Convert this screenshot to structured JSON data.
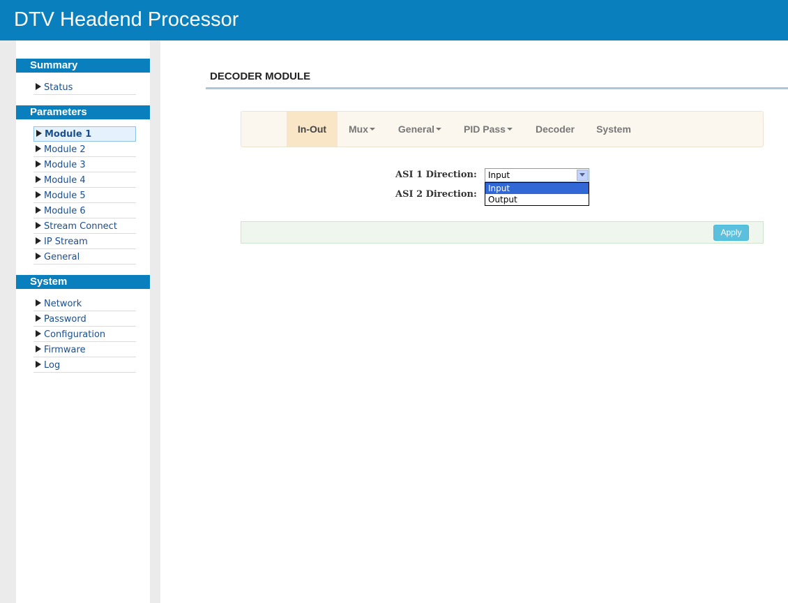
{
  "header": {
    "title": "DTV Headend Processor"
  },
  "sidebar": {
    "summary": {
      "heading": "Summary",
      "items": [
        {
          "label": "Status"
        }
      ]
    },
    "parameters": {
      "heading": "Parameters",
      "items": [
        {
          "label": "Module 1",
          "active": true
        },
        {
          "label": "Module 2"
        },
        {
          "label": "Module 3"
        },
        {
          "label": "Module 4"
        },
        {
          "label": "Module 5"
        },
        {
          "label": "Module 6"
        },
        {
          "label": "Stream Connect"
        },
        {
          "label": "IP Stream"
        },
        {
          "label": "General"
        }
      ]
    },
    "system": {
      "heading": "System",
      "items": [
        {
          "label": "Network"
        },
        {
          "label": "Password"
        },
        {
          "label": "Configuration"
        },
        {
          "label": "Firmware"
        },
        {
          "label": "Log"
        }
      ]
    }
  },
  "main": {
    "title": "DECODER MODULE",
    "tabs": [
      {
        "label": "In-Out",
        "active": true,
        "dropdown": false
      },
      {
        "label": "Mux",
        "dropdown": true
      },
      {
        "label": "General",
        "dropdown": true
      },
      {
        "label": "PID Pass",
        "dropdown": true
      },
      {
        "label": "Decoder",
        "dropdown": false
      },
      {
        "label": "System",
        "dropdown": false
      }
    ],
    "form": {
      "asi1": {
        "label": "ASI 1 Direction:",
        "value": "Input",
        "options": [
          "Input",
          "Output"
        ],
        "highlighted_option": "Input"
      },
      "asi2": {
        "label": "ASI 2 Direction:"
      }
    },
    "apply_label": "Apply"
  },
  "colors": {
    "brand_blue": "#0a7fbe",
    "tab_active_bg": "#f8e6c6",
    "apply_button": "#5bc0de",
    "dropdown_highlight": "#3168d5"
  }
}
